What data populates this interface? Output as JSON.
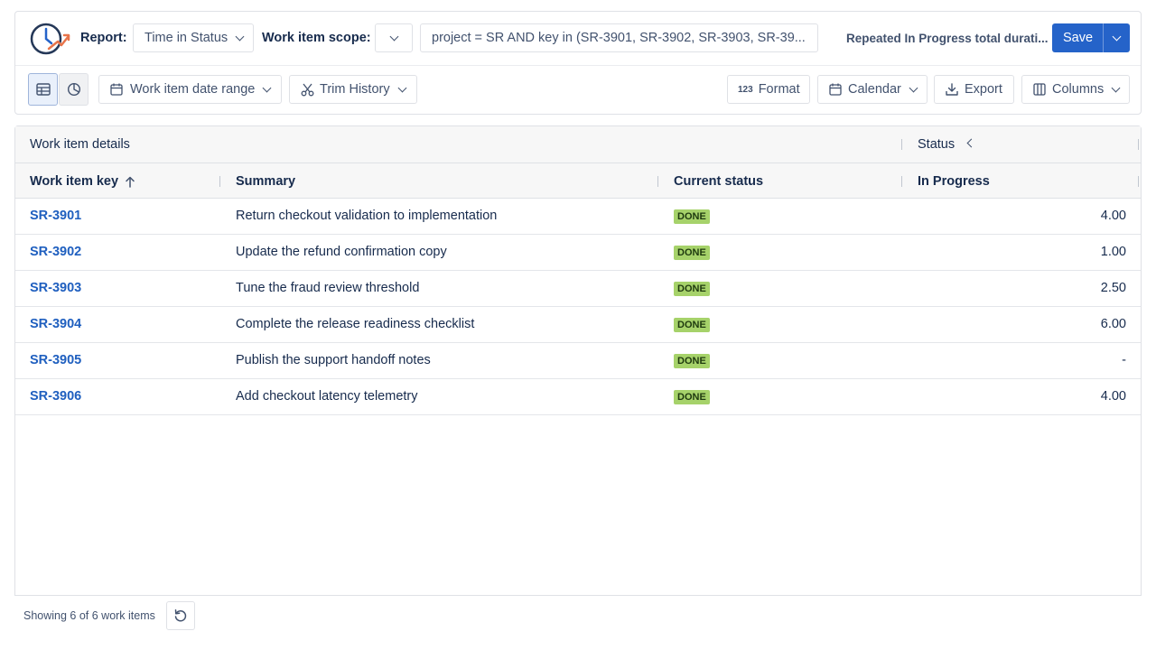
{
  "header": {
    "report_label": "Report:",
    "report_value": "Time in Status",
    "scope_label": "Work item scope:",
    "query": "project = SR AND key in (SR-3901, SR-3902, SR-3903, SR-39...",
    "saved_name": "Repeated In Progress total durati...",
    "save_label": "Save"
  },
  "toolbar": {
    "date_range_label": "Work item date range",
    "trim_label": "Trim History",
    "format_label": "Format",
    "calendar_label": "Calendar",
    "export_label": "Export",
    "columns_label": "Columns"
  },
  "table": {
    "group_headers": {
      "details": "Work item details",
      "status": "Status"
    },
    "columns": {
      "key": "Work item key",
      "summary": "Summary",
      "current_status": "Current status",
      "in_progress": "In Progress"
    },
    "rows": [
      {
        "key": "SR-3901",
        "summary": "Return checkout validation to implementation",
        "status": "DONE",
        "in_progress": "4.00"
      },
      {
        "key": "SR-3902",
        "summary": "Update the refund confirmation copy",
        "status": "DONE",
        "in_progress": "1.00"
      },
      {
        "key": "SR-3903",
        "summary": "Tune the fraud review threshold",
        "status": "DONE",
        "in_progress": "2.50"
      },
      {
        "key": "SR-3904",
        "summary": "Complete the release readiness checklist",
        "status": "DONE",
        "in_progress": "6.00"
      },
      {
        "key": "SR-3905",
        "summary": "Publish the support handoff notes",
        "status": "DONE",
        "in_progress": "-"
      },
      {
        "key": "SR-3906",
        "summary": "Add checkout latency telemetry",
        "status": "DONE",
        "in_progress": "4.00"
      }
    ]
  },
  "footer": {
    "showing_text": "Showing 6 of 6 work items"
  },
  "colors": {
    "accent": "#2563c9",
    "link": "#1f5fbf",
    "done_badge": "#a6d26a"
  }
}
